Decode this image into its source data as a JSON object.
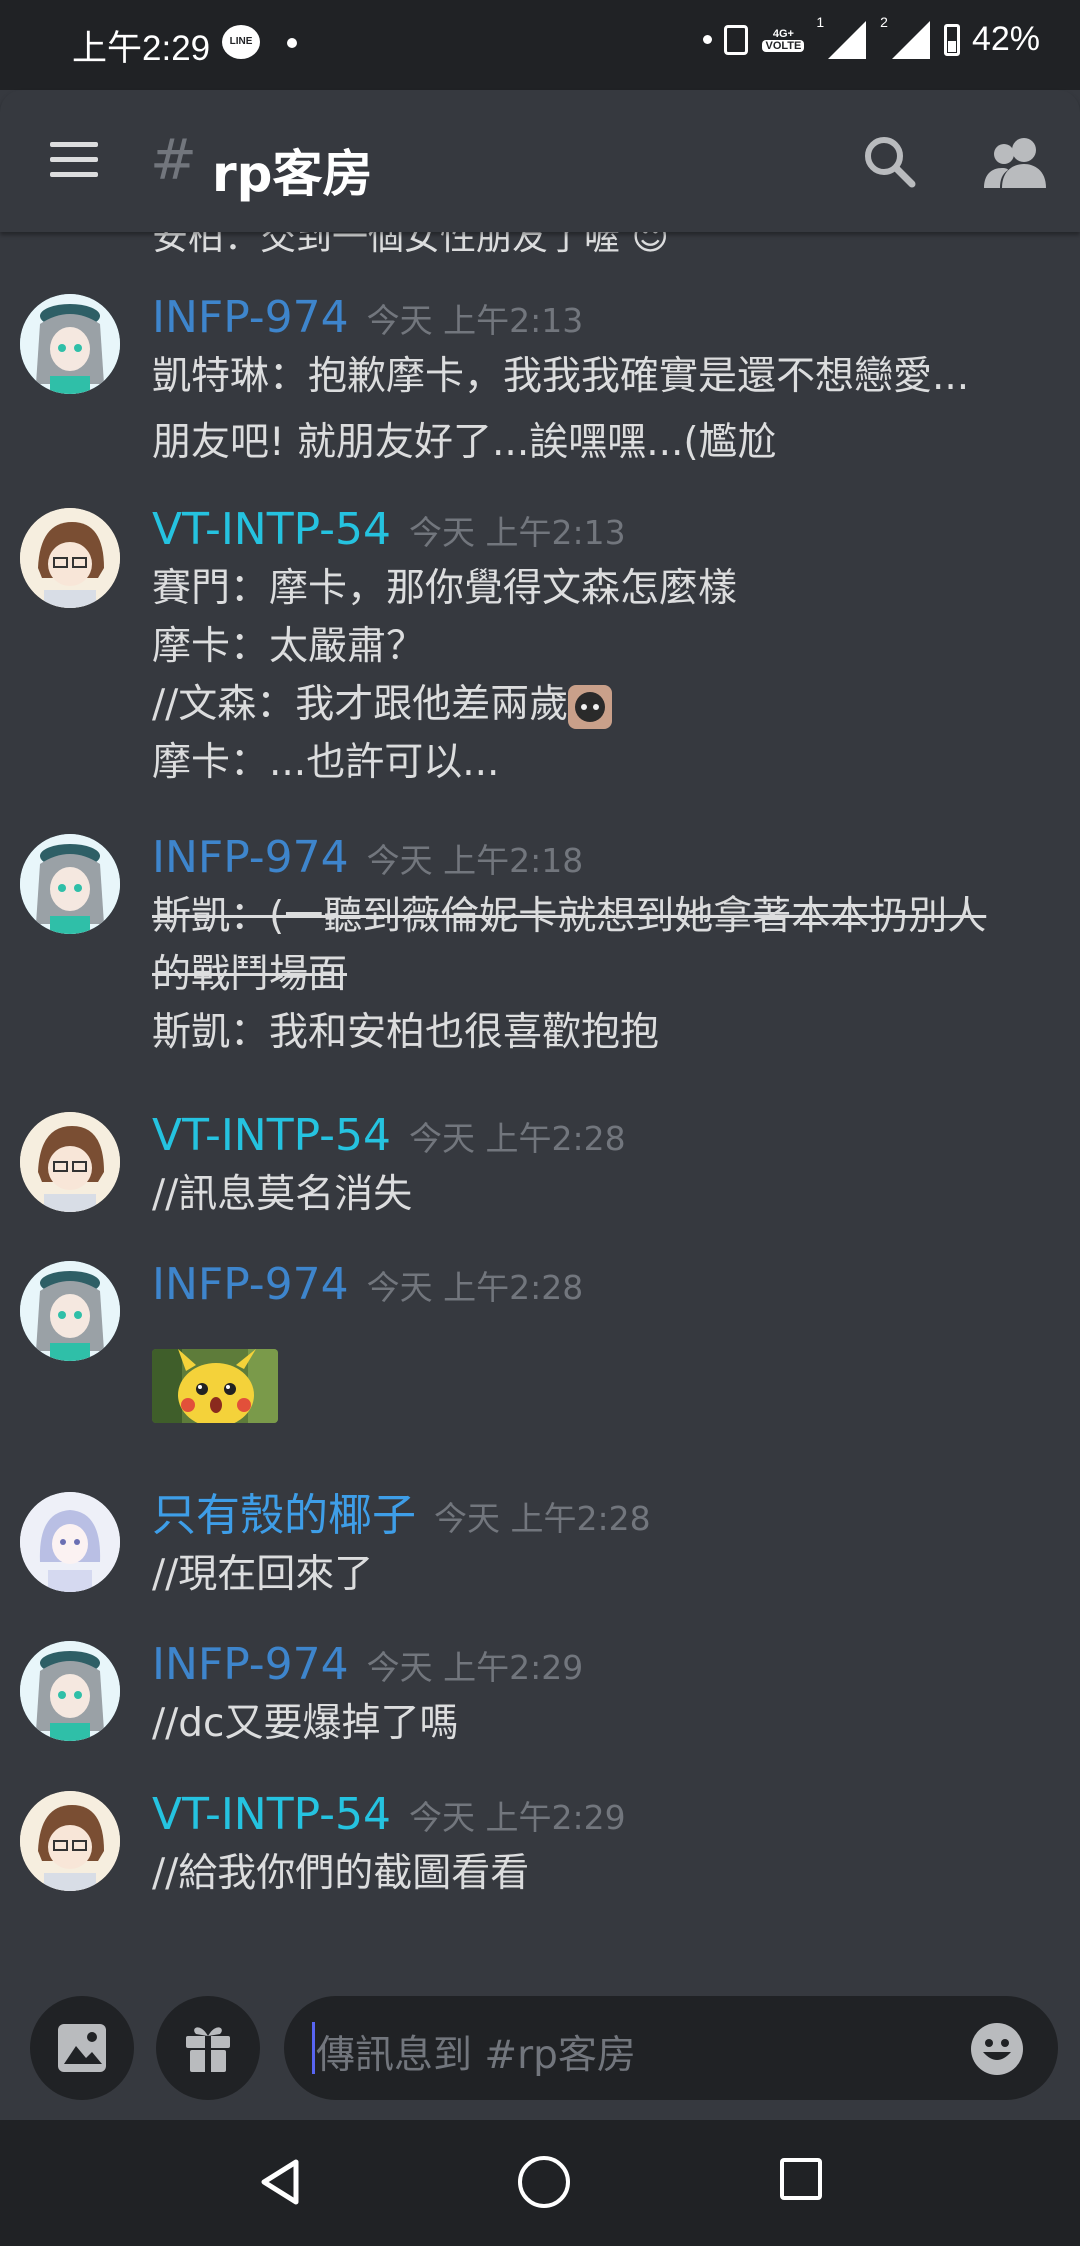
{
  "status_bar": {
    "time": "上午2:29",
    "line_badge": "LINE",
    "network": "4G+",
    "volte": "VOLTE",
    "sim1": "1",
    "sim2": "2",
    "battery": "42%"
  },
  "header": {
    "hash": "#",
    "channel": "rp客房"
  },
  "cutoff_text": "安柏：交到一個女性朋友了喔 ☺",
  "messages": [
    {
      "author": "INFP-974",
      "timestamp": "今天 上午2:13",
      "author_color": "#3e85cc",
      "lines": [
        "凱特琳：抱歉摩卡，我我我確實是還不想戀愛...",
        "朋友吧! 就朋友好了...誒嘿嘿...(尷尬"
      ]
    },
    {
      "author": "VT-INTP-54",
      "timestamp": "今天 上午2:13",
      "author_color": "#25c3e0",
      "lines": [
        "賽門：摩卡，那你覺得文森怎麼樣",
        "摩卡：太嚴肅？",
        "//文森：我才跟他差兩歲",
        "摩卡：...也許可以..."
      ]
    },
    {
      "author": "INFP-974",
      "timestamp": "今天 上午2:18",
      "author_color": "#3e85cc",
      "lines_struck": [
        "斯凱：(一聽到薇倫妮卡就想到她拿著本本扔別人",
        "的戰鬥場面"
      ],
      "lines": [
        "斯凱：我和安柏也很喜歡抱抱"
      ]
    },
    {
      "author": "VT-INTP-54",
      "timestamp": "今天 上午2:28",
      "author_color": "#25c3e0",
      "lines": [
        "//訊息莫名消失"
      ]
    },
    {
      "author": "INFP-974",
      "timestamp": "今天 上午2:28",
      "author_color": "#3e85cc",
      "attachment": "surprised-pikachu-image"
    },
    {
      "author": "只有殼的椰子",
      "timestamp": "今天 上午2:28",
      "author_color": "#3e9ee8",
      "lines": [
        "//現在回來了"
      ]
    },
    {
      "author": "INFP-974",
      "timestamp": "今天 上午2:29",
      "author_color": "#3e85cc",
      "lines": [
        "//dc又要爆掉了嗎"
      ]
    },
    {
      "author": "VT-INTP-54",
      "timestamp": "今天 上午2:29",
      "author_color": "#25c3e0",
      "lines": [
        "//給我你們的截圖看看"
      ]
    }
  ],
  "composer": {
    "placeholder": "傳訊息到 #rp客房"
  },
  "colors": {
    "background": "#36393f",
    "dark": "#202225",
    "text": "#dcddde",
    "muted": "#72767d"
  }
}
